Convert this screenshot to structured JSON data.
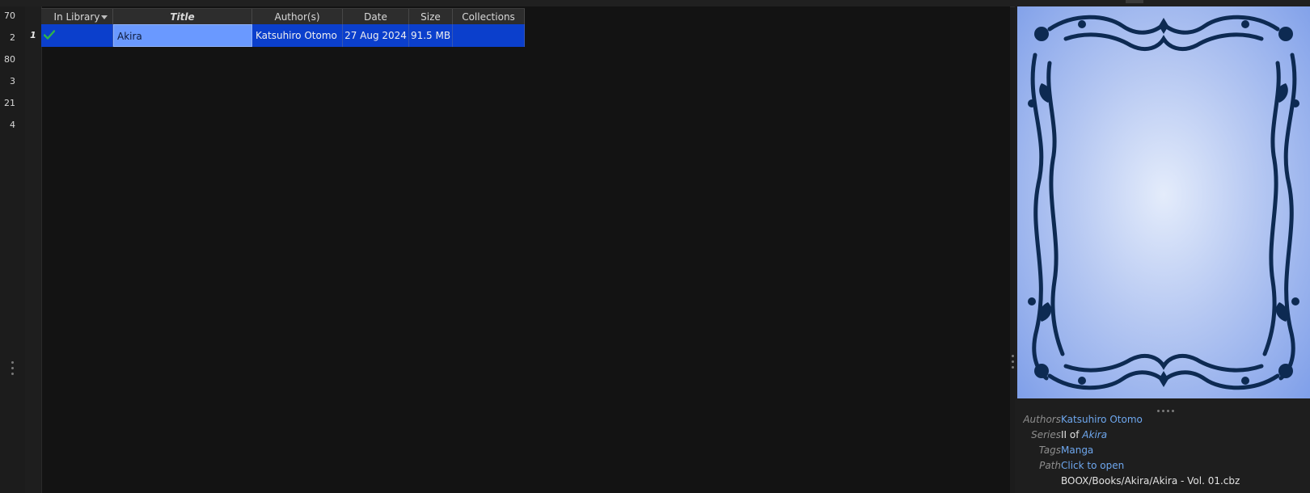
{
  "left_panel": {
    "counts": [
      "70",
      "2",
      "80",
      "3",
      "21",
      "4"
    ]
  },
  "book_list": {
    "columns": [
      {
        "key": "in_library",
        "label": "In Library",
        "width": 89
      },
      {
        "key": "title",
        "label": "Title",
        "width": 172
      },
      {
        "key": "authors",
        "label": "Author(s)",
        "width": 112
      },
      {
        "key": "date",
        "label": "Date",
        "width": 82
      },
      {
        "key": "size",
        "label": "Size",
        "width": 54
      },
      {
        "key": "collections",
        "label": "Collections",
        "width": 89
      }
    ],
    "sorted_column": "title",
    "rows": [
      {
        "row_number": "1",
        "in_library": "check-icon",
        "title": "Akira",
        "authors": "Katsuhiro Otomo",
        "date": "27 Aug 2024",
        "size": "91.5 MB",
        "collections": ""
      }
    ]
  },
  "details": {
    "authors_label": "Authors",
    "authors_value": "Katsuhiro Otomo",
    "series_label": "Series",
    "series_prefix": "II of",
    "series_name": "Akira",
    "tags_label": "Tags",
    "tags_value": "Manga",
    "path_label": "Path",
    "path_link": "Click to open",
    "path_value": "BOOX/Books/Akira/Akira - Vol. 01.cbz"
  },
  "colors": {
    "selection": "#0b3fcc",
    "current_cell": "#6a99ff",
    "link": "#6ea7ee",
    "check": "#2fb34a",
    "cover_ornament": "#0d2a52"
  }
}
